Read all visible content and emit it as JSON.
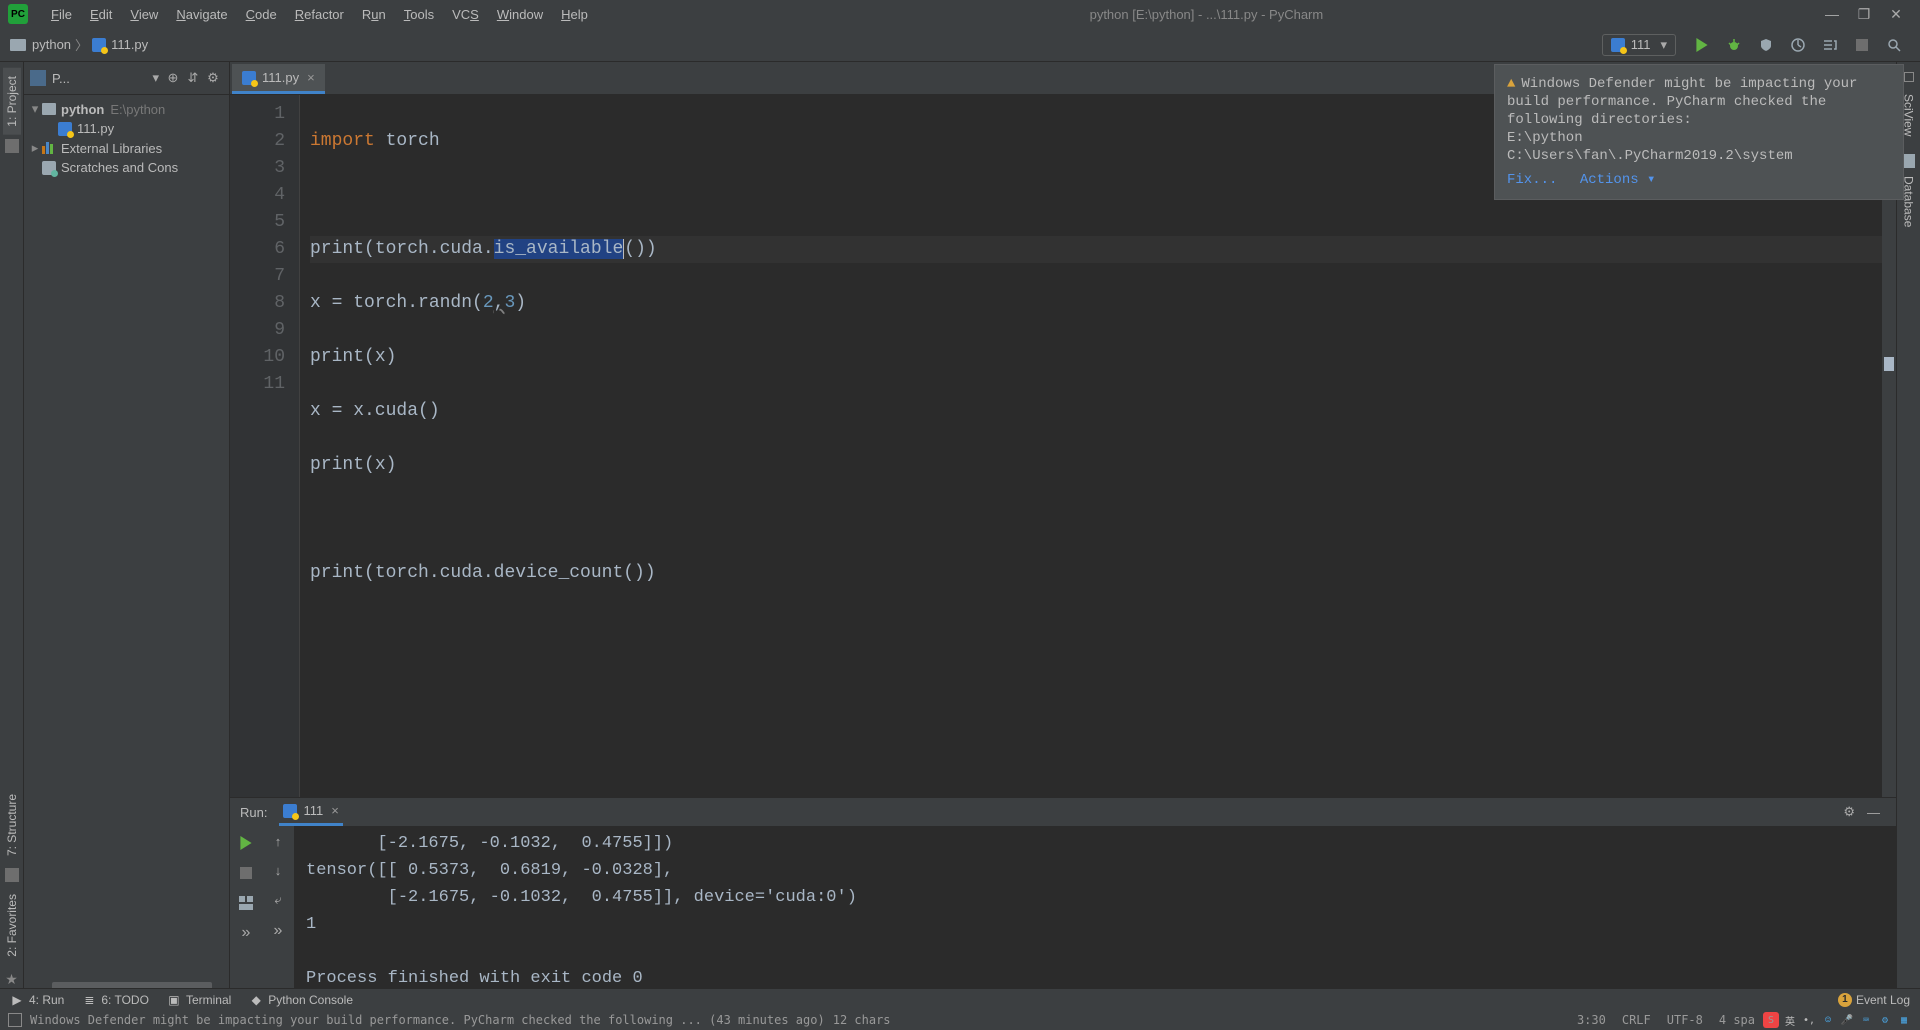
{
  "menubar": {
    "items": [
      "File",
      "Edit",
      "View",
      "Navigate",
      "Code",
      "Refactor",
      "Run",
      "Tools",
      "VCS",
      "Window",
      "Help"
    ],
    "title": "python [E:\\python] - ...\\111.py - PyCharm"
  },
  "breadcrumb": {
    "root": "python",
    "file": "111.py"
  },
  "run_config": {
    "name": "111"
  },
  "project_tree": {
    "root": "python",
    "root_path": "E:\\python",
    "file": "111.py",
    "ext_lib": "External Libraries",
    "scratches": "Scratches and Cons"
  },
  "project_header": {
    "label": "P..."
  },
  "tabs": [
    {
      "name": "111.py"
    }
  ],
  "code": {
    "lines_count": 11,
    "l1_kw": "import",
    "l1_rest": " torch",
    "l3_a": "print",
    "l3_b": "(torch.cuda.",
    "l3_hl": "is_available",
    "l3_c": "())",
    "l4_a": "x = torch.randn(",
    "l4_n1": "2",
    "l4_c": ",",
    "l4_n2": "3",
    "l4_d": ")",
    "l5": "print",
    "l5_b": "(x)",
    "l6": "x = x.cuda()",
    "l7": "print",
    "l7_b": "(x)",
    "l9": "print",
    "l9_b": "(torch.cuda.device_count())"
  },
  "run_panel": {
    "label": "Run:",
    "tab": "111",
    "console": "       [-2.1675, -0.1032,  0.4755]])\ntensor([[ 0.5373,  0.6819, -0.0328],\n        [-2.1675, -0.1032,  0.4755]], device='cuda:0')\n1\n\nProcess finished with exit code 0"
  },
  "notification": {
    "text": "Windows Defender might be impacting your build performance. PyCharm checked the following directories:\nE:\\python\nC:\\Users\\fan\\.PyCharm2019.2\\system",
    "fix": "Fix...",
    "actions": "Actions"
  },
  "bottom_tools": {
    "run": "4: Run",
    "todo": "6: TODO",
    "terminal": "Terminal",
    "python_console": "Python Console",
    "event_log": "Event Log",
    "event_badge": "1"
  },
  "statusbar": {
    "msg": "Windows Defender might be impacting your build performance. PyCharm checked the following ... (43 minutes ago)",
    "chars": "12 chars",
    "pos": "3:30",
    "eol": "CRLF",
    "enc": "UTF-8",
    "indent": "4 spa"
  },
  "left_tabs": {
    "project": "1: Project",
    "structure": "7: Structure",
    "favorites": "2: Favorites"
  },
  "right_tabs": {
    "sciview": "SciView",
    "database": "Database"
  }
}
